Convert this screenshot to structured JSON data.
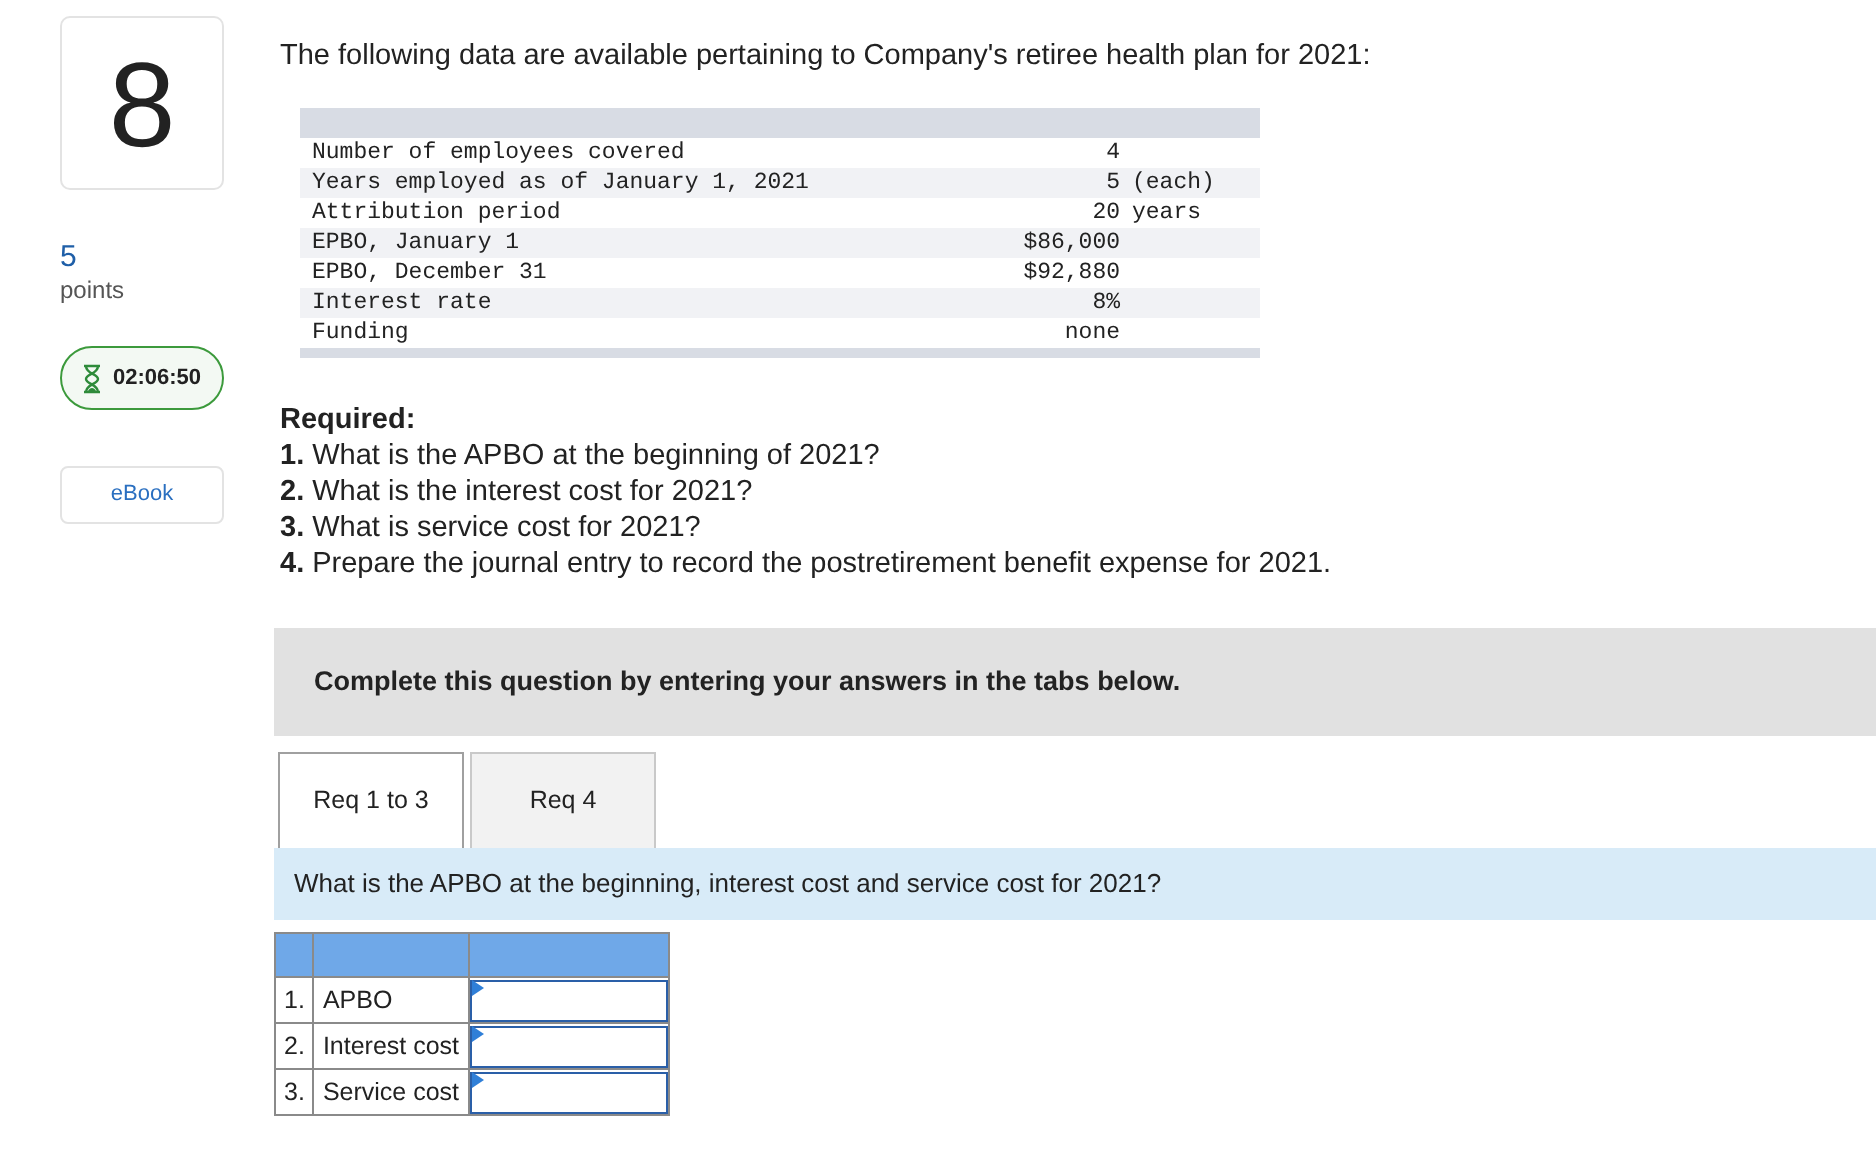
{
  "question": {
    "number": "8",
    "points": "5",
    "points_label": "points",
    "timer": "02:06:50",
    "ebook": "eBook"
  },
  "intro": "The following data are available pertaining to Company's retiree health plan for 2021:",
  "data_table": [
    {
      "label": "Number of employees covered",
      "value": "4",
      "shaded": false
    },
    {
      "label": "Years employed as of January 1, 2021",
      "value": "5",
      "unit": "(each)",
      "shaded": true
    },
    {
      "label": "Attribution period",
      "value": "20",
      "unit": "years",
      "shaded": false
    },
    {
      "label": "EPBO, January 1",
      "value": "$86,000",
      "shaded": true
    },
    {
      "label": "EPBO, December 31",
      "value": "$92,880",
      "shaded": false
    },
    {
      "label": "Interest rate",
      "value": "8%",
      "shaded": true
    },
    {
      "label": "Funding",
      "value": "none",
      "shaded": false
    }
  ],
  "required": {
    "heading": "Required:",
    "items": [
      "**1.** What is the APBO at the beginning of 2021?",
      "**2.** What is the interest cost for 2021?",
      "**3.** What is service cost for 2021?",
      "**4.** Prepare the journal entry to record the postretirement benefit expense for 2021."
    ]
  },
  "instruction": "Complete this question by entering your answers in the tabs below.",
  "tabs": [
    {
      "label": "Req 1 to 3",
      "selected": true
    },
    {
      "label": "Req 4",
      "selected": false
    }
  ],
  "tab_question": "What is the APBO at the beginning, interest cost and service cost for 2021?",
  "answer_rows": [
    {
      "number": "1.",
      "label": "APBO"
    },
    {
      "number": "2.",
      "label": "Interest cost"
    },
    {
      "number": "3.",
      "label": "Service cost"
    }
  ]
}
